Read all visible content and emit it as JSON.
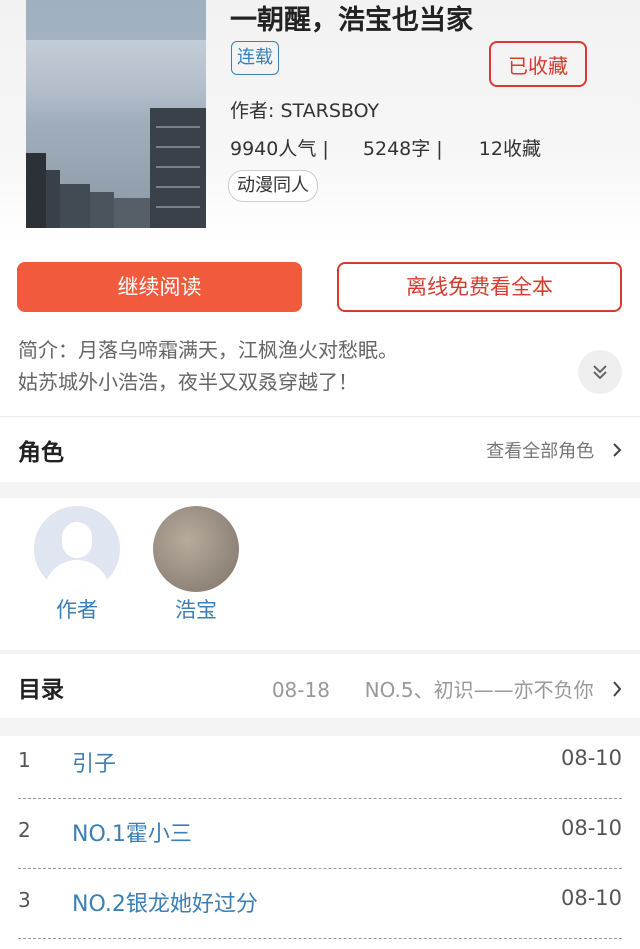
{
  "book": {
    "title": "一朝醒，浩宝也当家",
    "status": "连载",
    "collect_label": "已收藏",
    "author": "作者: STARSBOY",
    "popularity": "9940人气 |",
    "words": "5248字 |",
    "favorites": "12收藏",
    "tag": "动漫同人"
  },
  "actions": {
    "read_label": "继续阅读",
    "offline_label": "离线免费看全本"
  },
  "intro": {
    "line1": "简介：月落乌啼霜满天，江枫渔火对愁眠。",
    "line2": "姑苏城外小浩浩，夜半又双叒穿越了！"
  },
  "roles": {
    "title": "角色",
    "more_label": "查看全部角色",
    "items": [
      {
        "name": "作者"
      },
      {
        "name": "浩宝"
      }
    ]
  },
  "toc": {
    "title": "目录",
    "latest_date": "08-18",
    "latest_chapter": "NO.5、初识——亦不负你",
    "chapters": [
      {
        "num": "1",
        "name": "引子",
        "date": "08-10"
      },
      {
        "num": "2",
        "name": "NO.1霍小三",
        "date": "08-10"
      },
      {
        "num": "3",
        "name": "NO.2银龙她好过分",
        "date": "08-10"
      }
    ]
  },
  "colors": {
    "accent_red": "#d63b2e",
    "read_button": "#f15a3c",
    "link_blue": "#3c7fb6"
  }
}
